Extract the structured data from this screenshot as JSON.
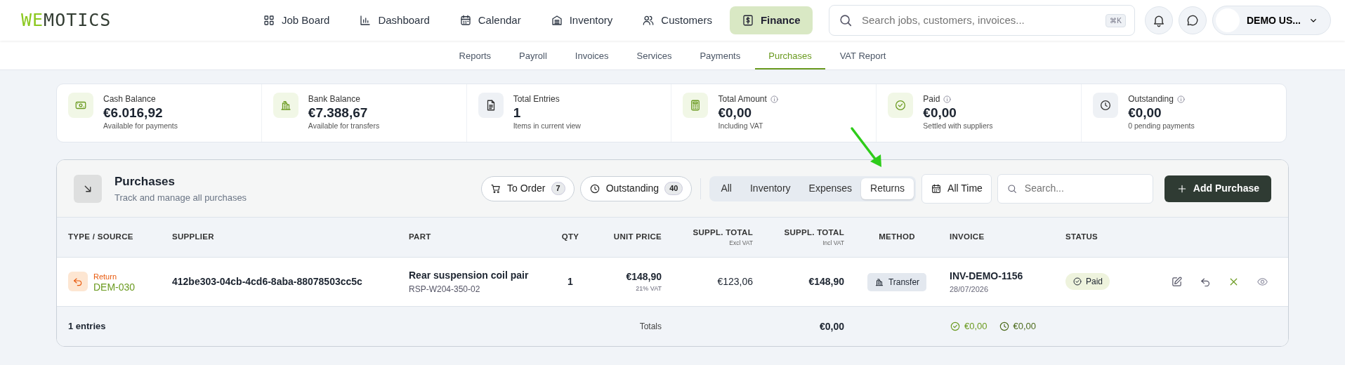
{
  "logo": {
    "accent": "WE",
    "rest": "MOTICS"
  },
  "nav": [
    {
      "label": "Job Board",
      "selected": false
    },
    {
      "label": "Dashboard",
      "selected": false
    },
    {
      "label": "Calendar",
      "selected": false
    },
    {
      "label": "Inventory",
      "selected": false
    },
    {
      "label": "Customers",
      "selected": false
    },
    {
      "label": "Finance",
      "selected": true
    }
  ],
  "search": {
    "placeholder": "Search jobs, customers, invoices...",
    "shortcut": "⌘K"
  },
  "user": {
    "name": "DEMO US..."
  },
  "subnav": [
    {
      "label": "Reports",
      "selected": false
    },
    {
      "label": "Payroll",
      "selected": false
    },
    {
      "label": "Invoices",
      "selected": false
    },
    {
      "label": "Services",
      "selected": false
    },
    {
      "label": "Payments",
      "selected": false
    },
    {
      "label": "Purchases",
      "selected": true
    },
    {
      "label": "VAT Report",
      "selected": false
    }
  ],
  "stats": [
    {
      "label": "Cash Balance",
      "value": "€6.016,92",
      "caption": "Available for payments",
      "info": false
    },
    {
      "label": "Bank Balance",
      "value": "€7.388,67",
      "caption": "Available for transfers",
      "info": false
    },
    {
      "label": "Total Entries",
      "value": "1",
      "caption": "Items in current view",
      "info": false
    },
    {
      "label": "Total Amount",
      "value": "€0,00",
      "caption": "Including VAT",
      "info": true
    },
    {
      "label": "Paid",
      "value": "€0,00",
      "caption": "Settled with suppliers",
      "info": true
    },
    {
      "label": "Outstanding",
      "value": "€0,00",
      "caption": "0 pending payments",
      "info": true
    }
  ],
  "purchases": {
    "title": "Purchases",
    "subtitle": "Track and manage all purchases",
    "filters": [
      {
        "label": "To Order",
        "count": "7"
      },
      {
        "label": "Outstanding",
        "count": "40"
      }
    ],
    "segments": [
      {
        "label": "All",
        "selected": false
      },
      {
        "label": "Inventory",
        "selected": false
      },
      {
        "label": "Expenses",
        "selected": false
      },
      {
        "label": "Returns",
        "selected": true
      }
    ],
    "period": "All Time",
    "search_placeholder": "Search...",
    "add_button": "Add Purchase"
  },
  "table": {
    "columns": [
      {
        "label": "TYPE / SOURCE"
      },
      {
        "label": "SUPPLIER"
      },
      {
        "label": "PART"
      },
      {
        "label": "QTY"
      },
      {
        "label": "UNIT PRICE"
      },
      {
        "label": "SUPPL. TOTAL",
        "sub": "Excl VAT"
      },
      {
        "label": "SUPPL. TOTAL",
        "sub": "Incl VAT"
      },
      {
        "label": "METHOD"
      },
      {
        "label": "INVOICE"
      },
      {
        "label": "STATUS"
      }
    ],
    "rows": [
      {
        "type": "Return",
        "source": "DEM-030",
        "supplier": "412be303-04cb-4cd6-8aba-88078503cc5c",
        "part": "Rear suspension coil pair",
        "part_no": "RSP-W204-350-02",
        "qty": "1",
        "unit_price": "€148,90",
        "vat": "21% VAT",
        "total_excl": "€123,06",
        "total_incl": "€148,90",
        "method": "Transfer",
        "invoice": "INV-DEMO-1156",
        "date": "28/07/2026",
        "status": "Paid"
      }
    ],
    "footer": {
      "entries": "1 entries",
      "totals_label": "Totals",
      "total_incl": "€0,00",
      "paid_total": "€0,00",
      "outstanding_total": "€0,00"
    }
  }
}
